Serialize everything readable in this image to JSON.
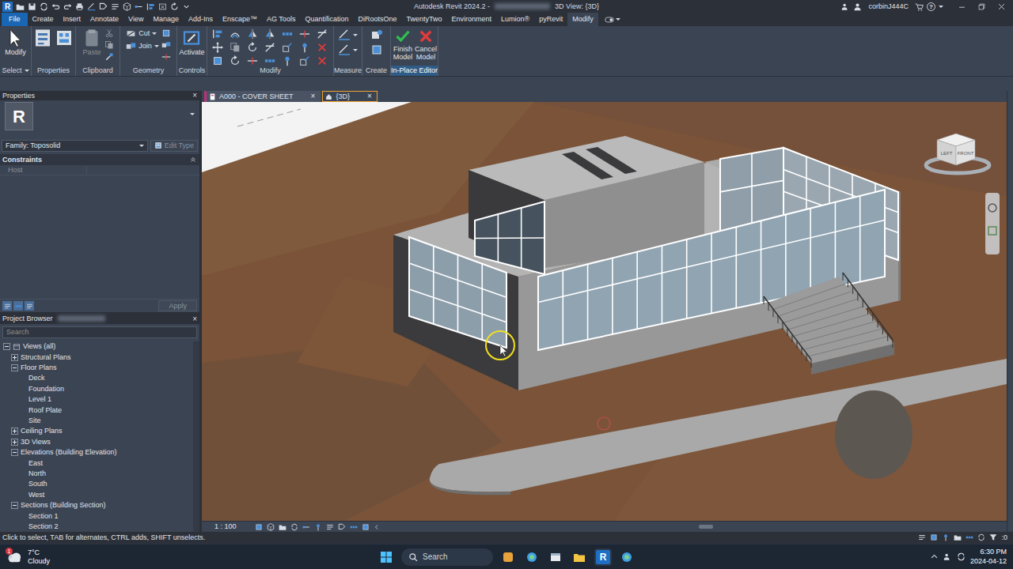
{
  "window": {
    "app_logo": "R",
    "title": "Autodesk Revit 2024.2 -",
    "view_title": "3D View: {3D}",
    "user": "corbinJ444C",
    "help": "?"
  },
  "ribbon": {
    "tabs": [
      {
        "label": "File",
        "kind": "application",
        "selected": false
      },
      {
        "label": "Create",
        "kind": "standard",
        "selected": false
      },
      {
        "label": "Insert",
        "kind": "standard",
        "selected": false
      },
      {
        "label": "Annotate",
        "kind": "standard",
        "selected": false
      },
      {
        "label": "View",
        "kind": "standard",
        "selected": false
      },
      {
        "label": "Manage",
        "kind": "standard",
        "selected": false
      },
      {
        "label": "Add-Ins",
        "kind": "standard",
        "selected": false
      },
      {
        "label": "Enscape™",
        "kind": "standard",
        "selected": false
      },
      {
        "label": "AG Tools",
        "kind": "standard",
        "selected": false
      },
      {
        "label": "Quantification",
        "kind": "standard",
        "selected": false
      },
      {
        "label": "DiRootsOne",
        "kind": "standard",
        "selected": false
      },
      {
        "label": "TwentyTwo",
        "kind": "standard",
        "selected": false
      },
      {
        "label": "Environment",
        "kind": "standard",
        "selected": false
      },
      {
        "label": "Lumion®",
        "kind": "standard",
        "selected": false
      },
      {
        "label": "pyRevit",
        "kind": "standard",
        "selected": false
      },
      {
        "label": "Modify",
        "kind": "standard",
        "selected": true
      }
    ],
    "panels": [
      {
        "label": "Select",
        "kind": "select",
        "dropdown": true,
        "highlighted": false,
        "buttons": [
          {
            "label": "Modify",
            "disabled": false
          }
        ]
      },
      {
        "label": "Properties",
        "kind": "properties",
        "dropdown": false,
        "highlighted": false,
        "buttons": []
      },
      {
        "label": "Clipboard",
        "kind": "clipboard",
        "dropdown": false,
        "highlighted": false,
        "buttons": [
          {
            "label": "Paste",
            "disabled": true
          }
        ]
      },
      {
        "label": "Geometry",
        "kind": "geometry",
        "dropdown": false,
        "highlighted": false,
        "buttons": [
          {
            "label": "Cut",
            "disabled": false
          },
          {
            "label": "Join",
            "disabled": false
          }
        ]
      },
      {
        "label": "Controls",
        "kind": "controls",
        "dropdown": false,
        "highlighted": false,
        "buttons": [
          {
            "label": "Activate",
            "disabled": false
          }
        ]
      },
      {
        "label": "Modify",
        "kind": "modify",
        "dropdown": false,
        "highlighted": false,
        "buttons": []
      },
      {
        "label": "Measure",
        "kind": "measure",
        "dropdown": false,
        "highlighted": false,
        "buttons": []
      },
      {
        "label": "Create",
        "kind": "create",
        "dropdown": false,
        "highlighted": false,
        "buttons": []
      },
      {
        "label": "In-Place Editor",
        "kind": "editor",
        "dropdown": false,
        "highlighted": true,
        "buttons": [
          {
            "label": "Finish Model",
            "disabled": false
          },
          {
            "label": "Cancel Model",
            "disabled": false
          }
        ]
      }
    ]
  },
  "properties": {
    "title": "Properties",
    "close": "×",
    "type_icon": "R",
    "family": "Family: Toposolid",
    "edit_type": {
      "label": "Edit Type",
      "disabled": true
    },
    "sections": [
      {
        "label": "Constraints",
        "rows": [
          {
            "label": "Host",
            "disabled": true
          }
        ]
      }
    ],
    "apply": {
      "label": "Apply",
      "disabled": true
    }
  },
  "project_browser": {
    "title": "Project Browser",
    "close": "×",
    "search": {
      "placeholder": "Search"
    },
    "tree": [
      {
        "label": "Views (all)",
        "expanded": true,
        "children": [
          {
            "label": "Structural Plans",
            "expanded": false,
            "children": []
          },
          {
            "label": "Floor Plans",
            "expanded": true,
            "children": [
              {
                "label": "Deck"
              },
              {
                "label": "Foundation"
              },
              {
                "label": "Level 1"
              },
              {
                "label": "Roof Plate"
              },
              {
                "label": "Site"
              }
            ]
          },
          {
            "label": "Ceiling Plans",
            "expanded": false,
            "children": []
          },
          {
            "label": "3D Views",
            "expanded": false,
            "children": []
          },
          {
            "label": "Elevations (Building Elevation)",
            "expanded": true,
            "children": [
              {
                "label": "East"
              },
              {
                "label": "North"
              },
              {
                "label": "South"
              },
              {
                "label": "West"
              }
            ]
          },
          {
            "label": "Sections (Building Section)",
            "expanded": true,
            "children": [
              {
                "label": "Section 1"
              },
              {
                "label": "Section 2"
              }
            ]
          }
        ]
      }
    ]
  },
  "view_tabs": [
    {
      "label": "A000 - COVER SHEET",
      "kind": "sheet",
      "selected": false,
      "close": "×"
    },
    {
      "label": "{3D}",
      "kind": "3d",
      "selected": true,
      "close": "×"
    }
  ],
  "view": {
    "viewcube": {
      "left": "LEFT",
      "front": "FRONT"
    },
    "scale": "1 : 100"
  },
  "status_bar": {
    "message": "Click to select, TAB for alternates, CTRL adds, SHIFT unselects.",
    "filter_count": ":0"
  },
  "taskbar": {
    "weather": {
      "temperature": "7°C",
      "condition": "Cloudy",
      "badge": "1"
    },
    "search": {
      "label": "Search"
    },
    "revit_icon": "R",
    "time": "6:30 PM",
    "date": "2024-04-12"
  }
}
